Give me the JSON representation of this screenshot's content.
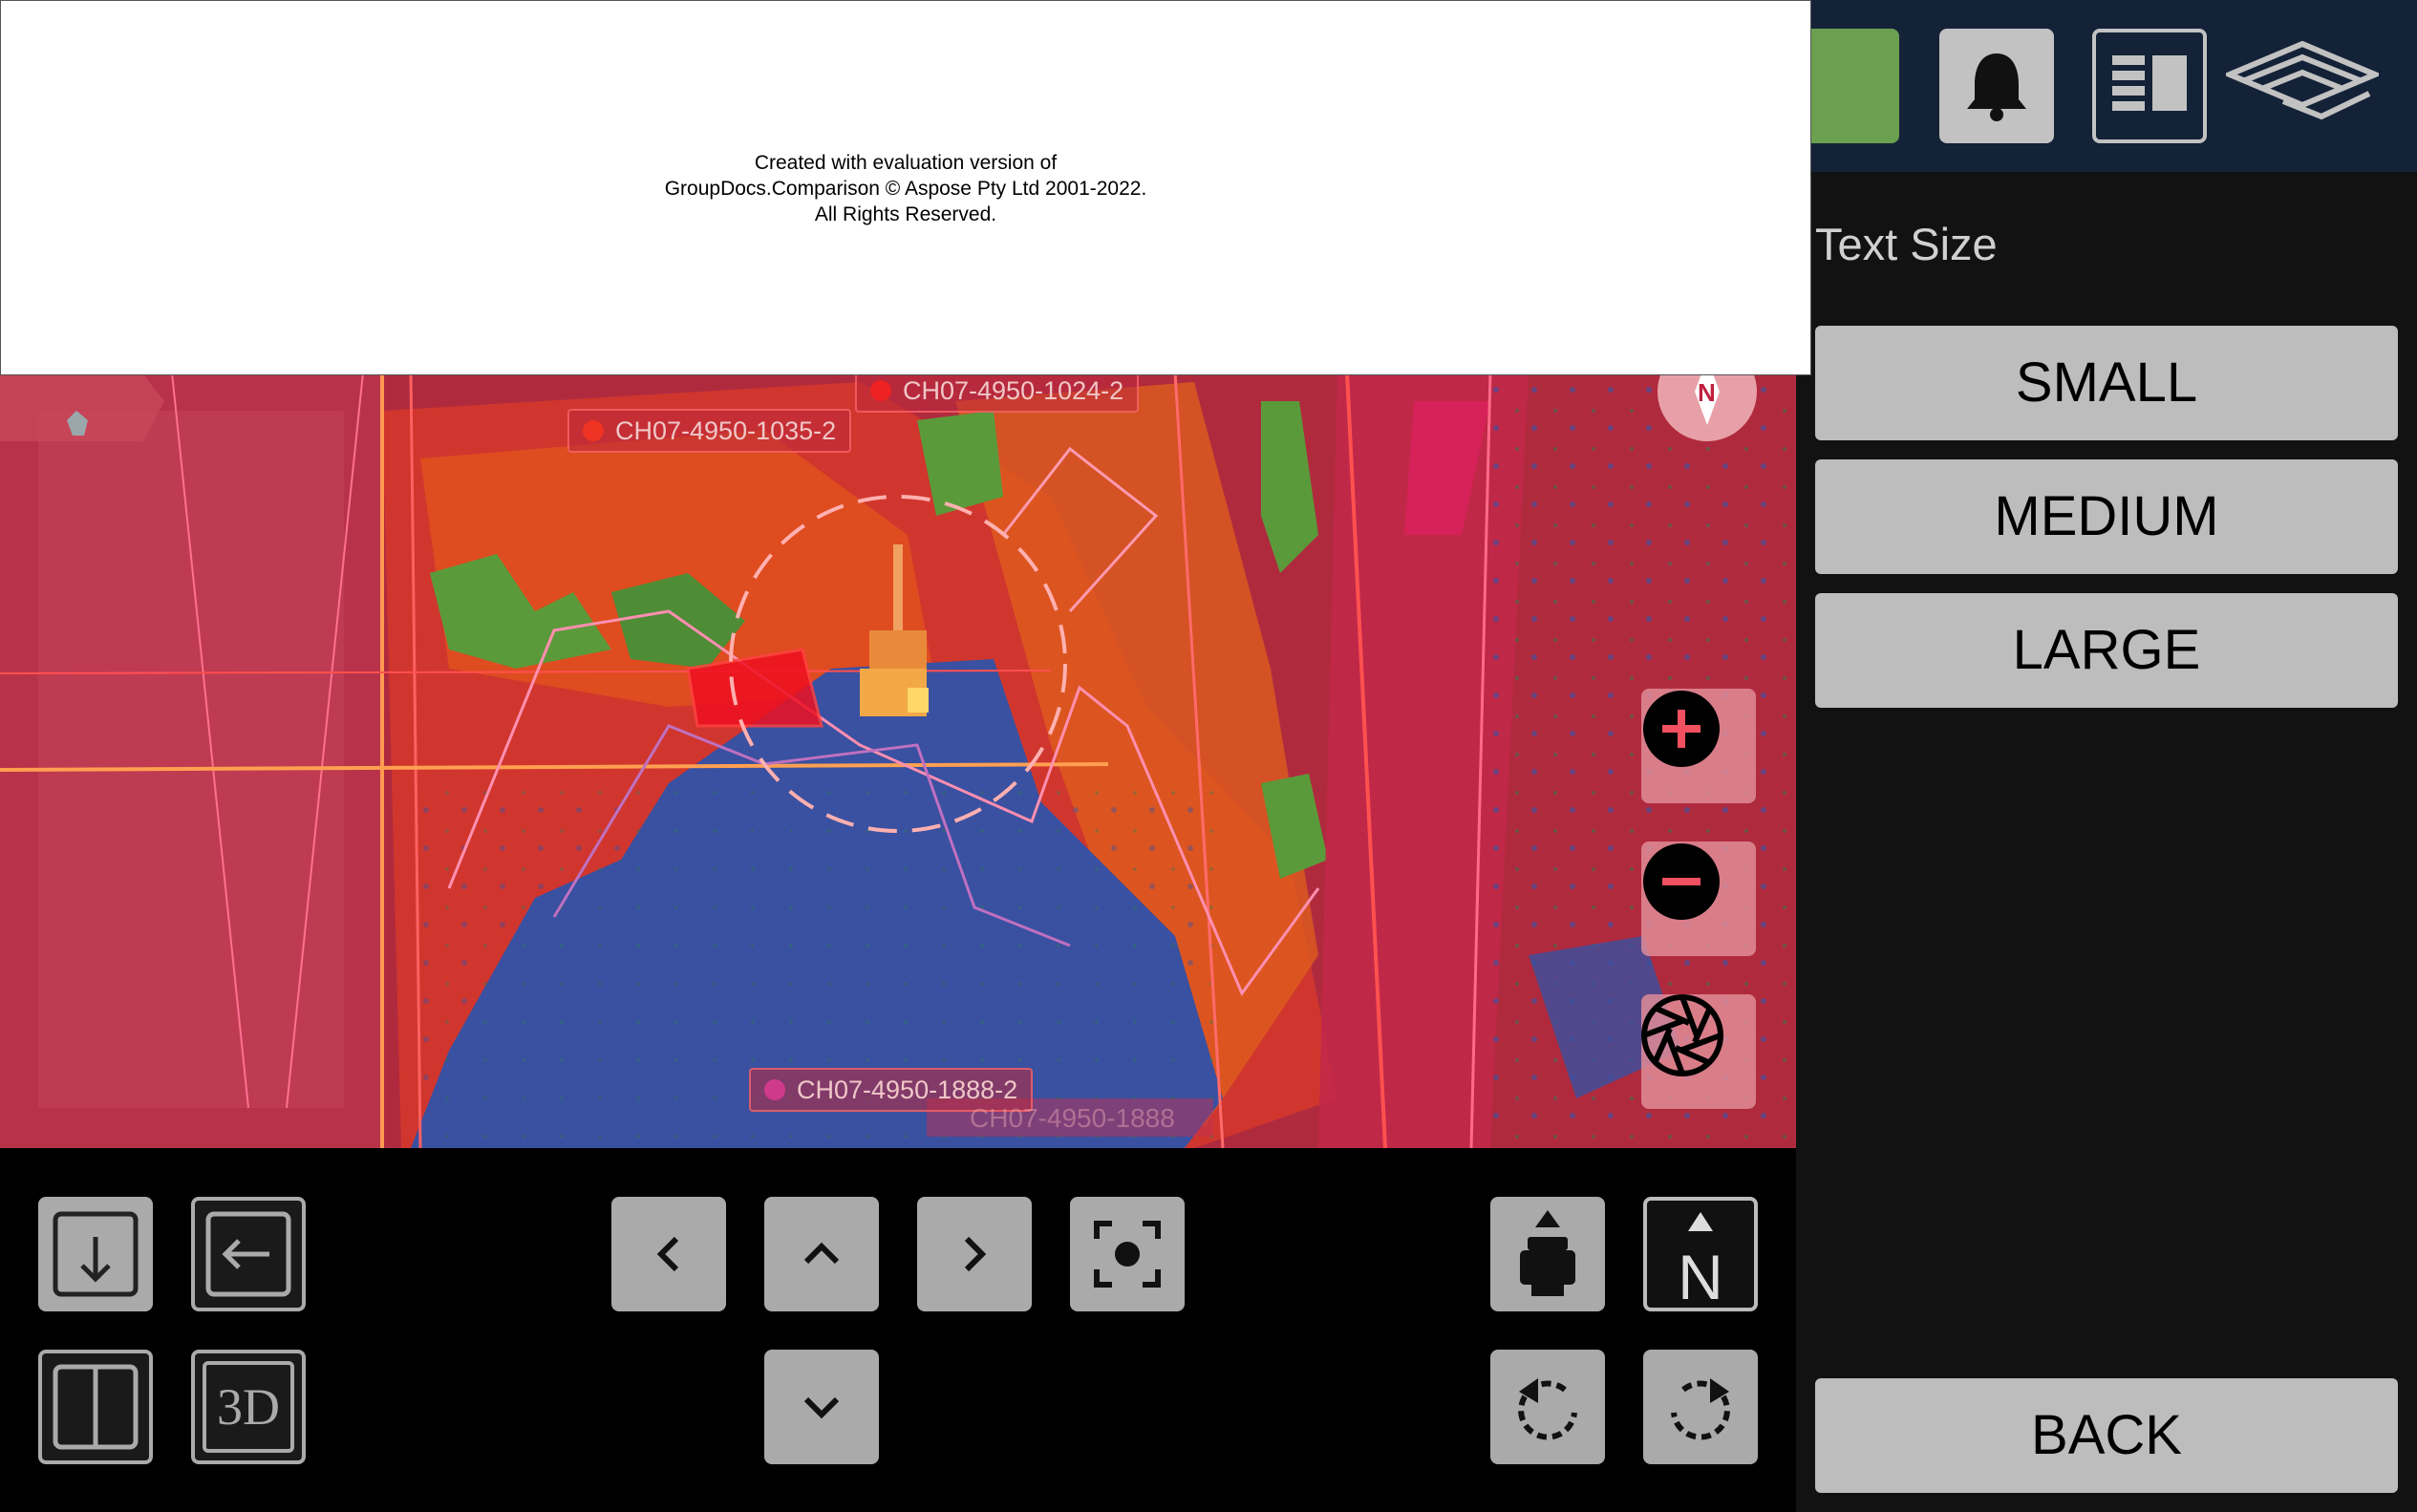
{
  "watermark": {
    "line1": "Created with evaluation version of",
    "line2": "GroupDocs.Comparison © Aspose Pty Ltd 2001-2022.",
    "line3": "All Rights Reserved."
  },
  "map": {
    "hole_labels": [
      {
        "text": "CH07-4950-1024-2",
        "dot_color": "#ee2222"
      },
      {
        "text": "CH07-4950-1035-2",
        "dot_color": "#ee3322"
      },
      {
        "text": "CH07-4950-1888-2",
        "dot_color": "#d03a8a"
      }
    ],
    "faded_label": "CH07-4950-1888",
    "controls": [
      {
        "name": "zoom-in",
        "icon": "plus-circle-icon"
      },
      {
        "name": "zoom-out",
        "icon": "minus-circle-icon"
      },
      {
        "name": "camera",
        "icon": "aperture-icon"
      }
    ],
    "compass_icon": "compass-icon"
  },
  "toolbar": {
    "left": [
      {
        "name": "download",
        "icon": "arrow-down-icon"
      },
      {
        "name": "back",
        "icon": "arrow-left-icon"
      },
      {
        "name": "split-view",
        "icon": "split-view-icon"
      },
      {
        "name": "3d-view",
        "label": "3D"
      }
    ],
    "pan": [
      {
        "name": "pan-left",
        "icon": "chevron-left-icon"
      },
      {
        "name": "pan-up",
        "icon": "chevron-up-icon"
      },
      {
        "name": "pan-right",
        "icon": "chevron-right-icon"
      },
      {
        "name": "pan-down",
        "icon": "chevron-down-icon"
      },
      {
        "name": "focus",
        "icon": "focus-target-icon"
      }
    ],
    "orientation": [
      {
        "name": "machine-up",
        "icon": "machine-up-icon"
      },
      {
        "name": "north-up",
        "label": "N"
      },
      {
        "name": "rotate-left",
        "icon": "rotate-ccw-icon"
      },
      {
        "name": "rotate-right",
        "icon": "rotate-cw-icon"
      }
    ]
  },
  "header": {
    "status_color": "#6aa050",
    "buttons": [
      {
        "name": "notifications",
        "icon": "bell-icon"
      },
      {
        "name": "layout",
        "icon": "panel-layout-icon"
      },
      {
        "name": "brand",
        "icon": "brand-logo-icon"
      }
    ]
  },
  "panel": {
    "title": "Text Size",
    "options": [
      "SMALL",
      "MEDIUM",
      "LARGE"
    ],
    "back": "BACK"
  },
  "colors": {
    "map_red": "#b02a3e",
    "map_blue": "#3a50a0",
    "map_orange": "#e0501c",
    "map_green": "#5b9a3a",
    "button_gray": "#aaaaaa",
    "panel_bg": "#121212",
    "header_bg": "#142238"
  }
}
